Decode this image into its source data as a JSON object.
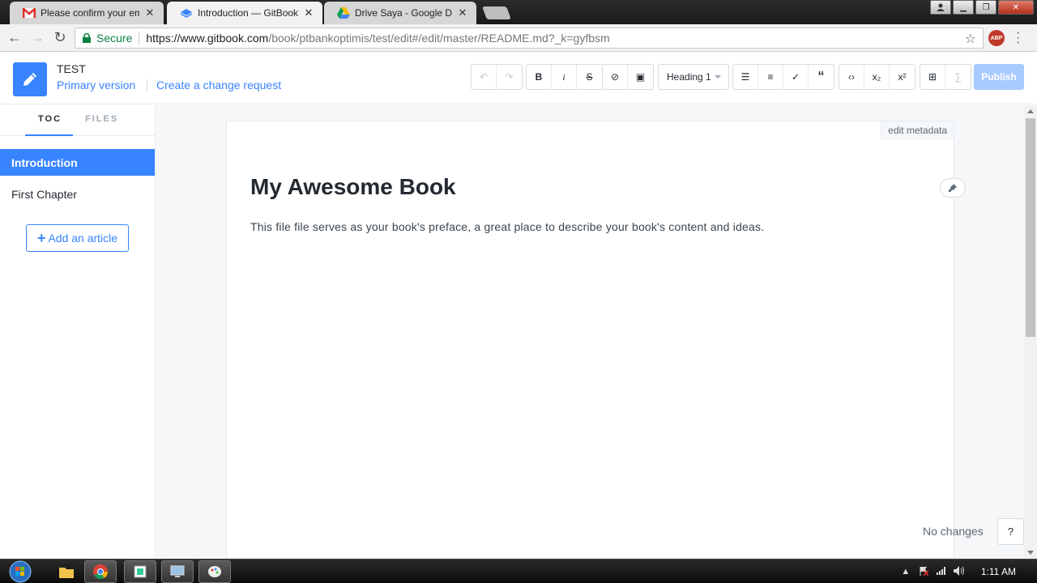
{
  "browser": {
    "tabs": [
      {
        "title": "Please confirm your ema",
        "favicon": "gmail-icon",
        "active": false
      },
      {
        "title": "Introduction — GitBook",
        "favicon": "gitbook-icon",
        "active": true
      },
      {
        "title": "Drive Saya - Google Driv",
        "favicon": "google-drive-icon",
        "active": false
      }
    ],
    "secure_label": "Secure",
    "url_host": "https://www.gitbook.com",
    "url_path": "/book/ptbankoptimis/test/edit#/edit/master/README.md?_k=gyfbsm",
    "extension_label": "ABP"
  },
  "header": {
    "book_name": "TEST",
    "version_link": "Primary version",
    "change_request_link": "Create a change request",
    "heading_select": "Heading 1",
    "publish_label": "Publish",
    "toolbar_glyphs": {
      "undo": "↶",
      "redo": "↷",
      "bold": "B",
      "italic": "i",
      "strike": "S",
      "link": "⊘",
      "image": "▣",
      "bullet_list": "☰",
      "ordered_list": "≡",
      "task_list": "✓",
      "quote": "“",
      "code": "‹›",
      "subscript": "x₂",
      "superscript": "x²",
      "table": "⊞",
      "math": "∑"
    }
  },
  "sidebar": {
    "tabs": [
      "TOC",
      "FILES"
    ],
    "items": [
      {
        "label": "Introduction",
        "active": true
      },
      {
        "label": "First Chapter",
        "active": false
      }
    ],
    "add_article_label": "Add an article"
  },
  "editor": {
    "edit_metadata_label": "edit metadata",
    "title": "My Awesome Book",
    "body": "This file file serves as your book's preface, a great place to describe your book's content and ideas.",
    "status": "No changes",
    "help_label": "?"
  },
  "taskbar": {
    "clock": "1:11 AM"
  },
  "colors": {
    "accent": "#3884ff",
    "publish_disabled": "#a8cbff",
    "text": "#242a31"
  }
}
